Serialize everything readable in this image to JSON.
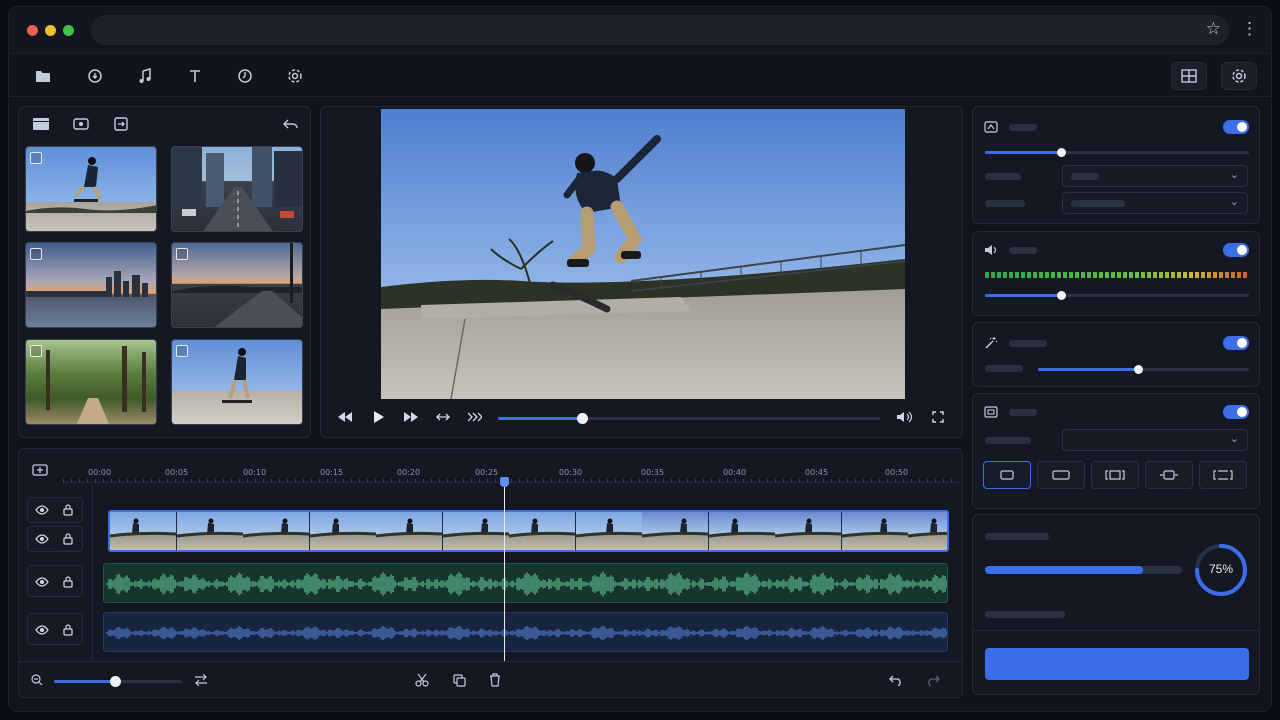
{
  "window": {
    "dots": [
      "#ec5f57",
      "#f1bc2e",
      "#3fc24a"
    ]
  },
  "toolbar": {
    "left_icons": [
      "folder-icon",
      "media-import-icon",
      "music-note-icon",
      "text-icon",
      "effects-icon",
      "settings-icon"
    ],
    "right_icons": [
      "layout-icon",
      "preferences-icon"
    ]
  },
  "media_panel": {
    "tab_icons": [
      "grid-view-icon",
      "screen-record-icon",
      "export-icon"
    ],
    "undo_icon": "undo-icon",
    "thumbnails": [
      "skater-jump-clip",
      "city-street-clip",
      "skyline-sunset-clip",
      "road-dusk-clip",
      "park-trees-clip",
      "skater-ride-clip"
    ]
  },
  "player": {
    "controls": [
      "rewind-icon",
      "play-icon",
      "fast-forward-icon",
      "loop-icon",
      "skip-icon"
    ],
    "progress": 0.22,
    "right_controls": [
      "volume-icon",
      "fullscreen-icon"
    ]
  },
  "timeline": {
    "ticks": [
      "00:00",
      "00:05",
      "00:10",
      "00:15",
      "00:20",
      "00:25",
      "00:30",
      "00:35",
      "00:40",
      "00:45",
      "00:50"
    ],
    "playhead": "00:25",
    "zoom": 0.48,
    "tracks": [
      "video",
      "overlay",
      "audio-music",
      "audio-voice"
    ]
  },
  "inspector": {
    "color": {
      "enabled": true,
      "slider": 0.29
    },
    "audio": {
      "enabled": true,
      "slider": 0.29
    },
    "magic": {
      "enabled": true,
      "slider": 0.48
    },
    "crop": {
      "enabled": true,
      "selected_shape": 0
    }
  },
  "export": {
    "progress": 0.8,
    "percent_label": "75%"
  },
  "colors": {
    "accent": "#3b6ee8",
    "waveform_green": "#6fd6a6",
    "waveform_blue": "#5c8de8",
    "panel": "#131823"
  }
}
